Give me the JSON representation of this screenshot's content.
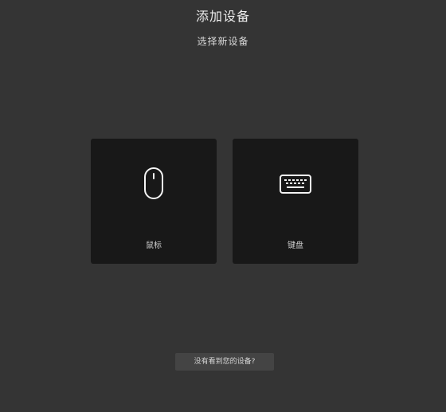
{
  "header": {
    "title": "添加设备",
    "subtitle": "选择新设备"
  },
  "devices": [
    {
      "label": "鼠标",
      "icon": "mouse-icon"
    },
    {
      "label": "键盘",
      "icon": "keyboard-icon"
    }
  ],
  "footer": {
    "help_label": "没有看到您的设备?"
  },
  "colors": {
    "background": "#343434",
    "card": "#181818",
    "button": "#444444",
    "text": "#e6e6e6"
  }
}
